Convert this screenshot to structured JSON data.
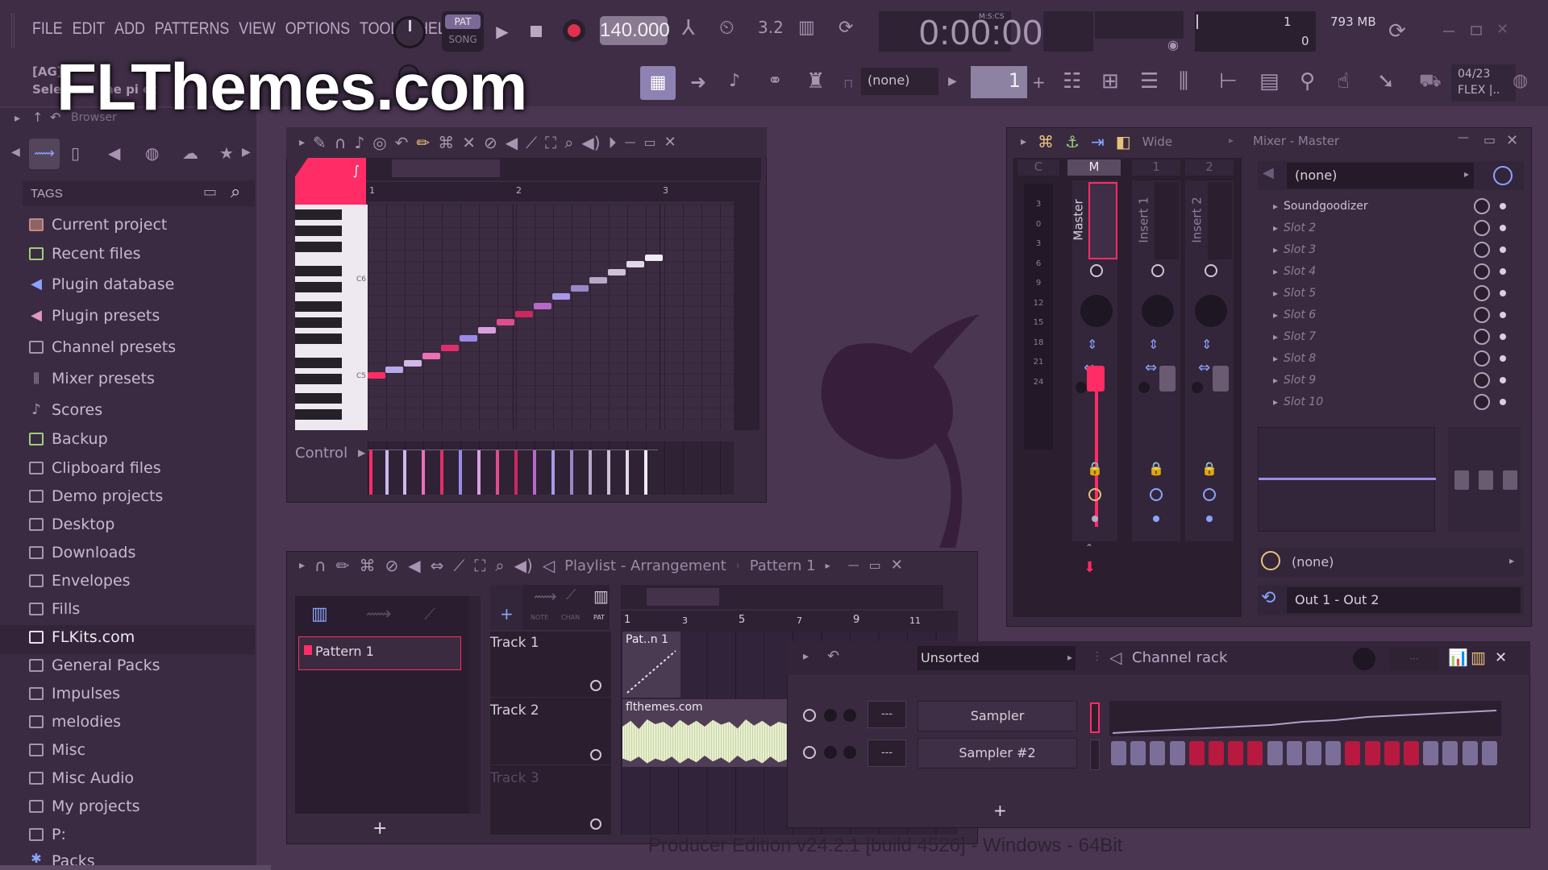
{
  "watermark": "FLThemes.com",
  "menu": [
    "FILE",
    "EDIT",
    "ADD",
    "PATTERNS",
    "VIEW",
    "OPTIONS",
    "TOOLS",
    "HELP"
  ],
  "transport": {
    "pat": "PAT",
    "song": "SONG",
    "tempo": "140.000",
    "time": "0:00:00",
    "time_label": "M:S:CS"
  },
  "cpu": {
    "value1": "1",
    "mem": "793 MB",
    "value2": "0"
  },
  "hint": {
    "line1": "[AG]",
    "line2": "Sele",
    "tail": "he pi et"
  },
  "snap_none": "(none)",
  "pattern_num": "1",
  "news": {
    "date": "04/23",
    "text": "FLEX |.."
  },
  "browser": {
    "header": "Browser",
    "tags": "TAGS",
    "items": [
      "Current project",
      "Recent files",
      "Plugin database",
      "Plugin presets",
      "Channel presets",
      "Mixer presets",
      "Scores",
      "Backup",
      "Clipboard files",
      "Demo projects",
      "Desktop",
      "Downloads",
      "Envelopes",
      "Fills",
      "FLKits.com",
      "General Packs",
      "Impulses",
      "melodies",
      "Misc",
      "Misc Audio",
      "My projects",
      "P:",
      "Packs"
    ]
  },
  "piano_roll": {
    "bars": [
      "1",
      "2",
      "3"
    ],
    "c6": "C6",
    "c5": "C5",
    "control": "Control"
  },
  "mixer": {
    "title": "Mixer - Master",
    "mode": "Wide",
    "tracks": [
      {
        "num": "C"
      },
      {
        "num": "M",
        "name": "Master"
      },
      {
        "num": "1",
        "name": "Insert 1"
      },
      {
        "num": "2",
        "name": "Insert 2"
      }
    ],
    "meter": [
      "3",
      "0",
      "3",
      "6",
      "9",
      "12",
      "15",
      "18",
      "21",
      "24"
    ],
    "preset": "(none)",
    "slots": [
      "Soundgoodizer",
      "Slot 2",
      "Slot 3",
      "Slot 4",
      "Slot 5",
      "Slot 6",
      "Slot 7",
      "Slot 8",
      "Slot 9",
      "Slot 10"
    ],
    "send": "(none)",
    "out": "Out 1 - Out 2"
  },
  "playlist": {
    "title": "Playlist - Arrangement",
    "pattern_sel": "Pattern 1",
    "pattern_item": "Pattern 1",
    "ruler_labels": [
      "NOTE",
      "CHAN",
      "PAT"
    ],
    "bars": [
      "1",
      "3",
      "5",
      "7",
      "9",
      "11"
    ],
    "tracks": [
      "Track 1",
      "Track 2",
      "Track 3"
    ],
    "clip1": "Pat..n 1",
    "clip2": "flthemes.com"
  },
  "channel_rack": {
    "filter": "Unsorted",
    "title": "Channel rack",
    "channels": [
      {
        "name": "Sampler",
        "num": "---"
      },
      {
        "name": "Sampler #2",
        "num": "---"
      }
    ],
    "steps": [
      0,
      0,
      0,
      0,
      1,
      1,
      1,
      1,
      0,
      0,
      0,
      0,
      1,
      1,
      1,
      1,
      0,
      0,
      0,
      0
    ]
  },
  "footer": "Producer Edition v24.2.1 [build 4526] - Windows - 64Bit"
}
